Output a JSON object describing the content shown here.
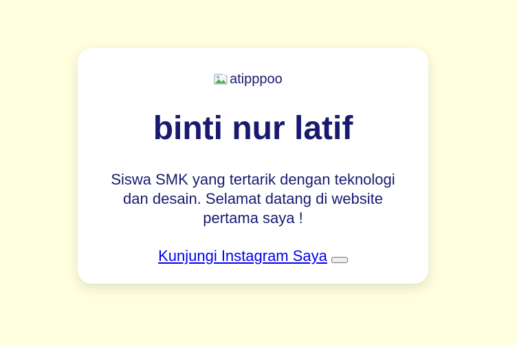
{
  "profile": {
    "image_alt": "atipppoo",
    "name": "binti nur latif",
    "bio": "Siswa SMK yang tertarik dengan teknologi dan desain. Selamat datang di website pertama saya !",
    "link_label": "Kunjungi Instagram Saya",
    "button_label": ""
  },
  "colors": {
    "background": "#ffffe0",
    "text": "#191970",
    "link": "#0000ee"
  },
  "icons": {
    "broken_image": "broken-image-icon"
  }
}
